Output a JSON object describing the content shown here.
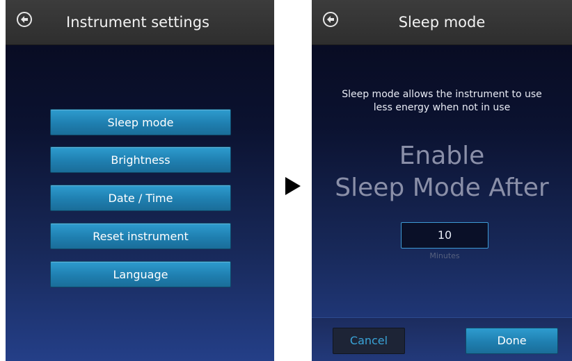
{
  "left_screen": {
    "title": "Instrument settings",
    "menu_items": [
      {
        "label": "Sleep mode"
      },
      {
        "label": "Brightness"
      },
      {
        "label": "Date / Time"
      },
      {
        "label": "Reset instrument"
      },
      {
        "label": "Language"
      }
    ]
  },
  "right_screen": {
    "title": "Sleep mode",
    "description_line1": "Sleep mode allows the instrument to use",
    "description_line2": "less energy when not in use",
    "heading_line1": "Enable",
    "heading_line2": "Sleep Mode After",
    "value": "10",
    "units": "Minutes",
    "cancel_label": "Cancel",
    "done_label": "Done"
  },
  "icons": {
    "back": "back-arrow-circle-icon",
    "transition": "play-triangle-icon"
  },
  "colors": {
    "accent": "#1f7fb0",
    "titlebar": "#333333",
    "cancel_text": "#3aa4d8"
  }
}
